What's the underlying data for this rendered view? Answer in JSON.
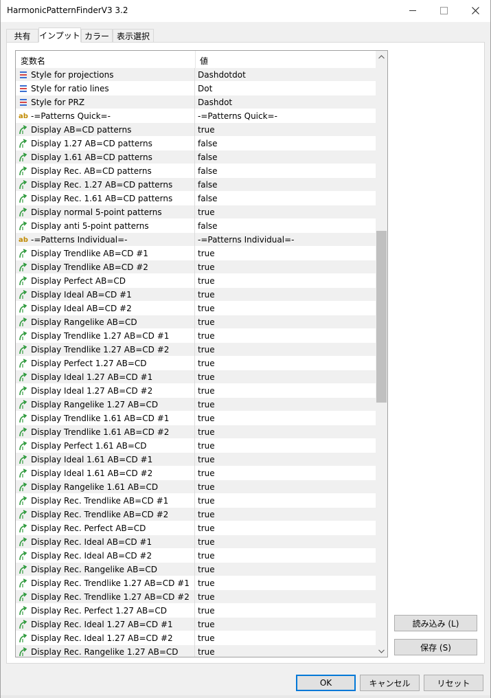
{
  "window": {
    "title": "HarmonicPatternFinderV3 3.2"
  },
  "tabs": [
    {
      "label": "共有",
      "active": false
    },
    {
      "label": "インプット",
      "active": true
    },
    {
      "label": "カラー",
      "active": false
    },
    {
      "label": "表示選択",
      "active": false
    }
  ],
  "grid": {
    "headers": {
      "name": "変数名",
      "value": "値"
    },
    "rows": [
      {
        "icon": "line-style-icon",
        "name": "Style for projections",
        "value": "Dashdotdot"
      },
      {
        "icon": "line-style-icon",
        "name": "Style for ratio lines",
        "value": "Dot"
      },
      {
        "icon": "line-style-icon",
        "name": "Style for PRZ",
        "value": "Dashdot"
      },
      {
        "icon": "string-ab-icon",
        "name": "-=Patterns Quick=-",
        "value": "-=Patterns Quick=-"
      },
      {
        "icon": "bool-arrow-icon",
        "name": "Display AB=CD patterns",
        "value": "true"
      },
      {
        "icon": "bool-arrow-icon",
        "name": "Display 1.27 AB=CD patterns",
        "value": "false"
      },
      {
        "icon": "bool-arrow-icon",
        "name": "Display 1.61 AB=CD patterns",
        "value": "false"
      },
      {
        "icon": "bool-arrow-icon",
        "name": "Display Rec. AB=CD patterns",
        "value": "false"
      },
      {
        "icon": "bool-arrow-icon",
        "name": "Display Rec. 1.27 AB=CD patterns",
        "value": "false"
      },
      {
        "icon": "bool-arrow-icon",
        "name": "Display Rec. 1.61 AB=CD patterns",
        "value": "false"
      },
      {
        "icon": "bool-arrow-icon",
        "name": "Display normal 5-point patterns",
        "value": "true"
      },
      {
        "icon": "bool-arrow-icon",
        "name": "Display anti 5-point patterns",
        "value": "false"
      },
      {
        "icon": "string-ab-icon",
        "name": "-=Patterns Individual=-",
        "value": "-=Patterns Individual=-"
      },
      {
        "icon": "bool-arrow-icon",
        "name": "Display Trendlike AB=CD #1",
        "value": "true"
      },
      {
        "icon": "bool-arrow-icon",
        "name": "Display Trendlike AB=CD #2",
        "value": "true"
      },
      {
        "icon": "bool-arrow-icon",
        "name": "Display Perfect AB=CD",
        "value": "true"
      },
      {
        "icon": "bool-arrow-icon",
        "name": "Display Ideal AB=CD #1",
        "value": "true"
      },
      {
        "icon": "bool-arrow-icon",
        "name": "Display Ideal AB=CD #2",
        "value": "true"
      },
      {
        "icon": "bool-arrow-icon",
        "name": "Display Rangelike AB=CD",
        "value": "true"
      },
      {
        "icon": "bool-arrow-icon",
        "name": "Display Trendlike 1.27 AB=CD #1",
        "value": "true"
      },
      {
        "icon": "bool-arrow-icon",
        "name": "Display Trendlike 1.27 AB=CD #2",
        "value": "true"
      },
      {
        "icon": "bool-arrow-icon",
        "name": "Display Perfect 1.27 AB=CD",
        "value": "true"
      },
      {
        "icon": "bool-arrow-icon",
        "name": "Display Ideal 1.27 AB=CD #1",
        "value": "true"
      },
      {
        "icon": "bool-arrow-icon",
        "name": "Display Ideal 1.27 AB=CD #2",
        "value": "true"
      },
      {
        "icon": "bool-arrow-icon",
        "name": "Display Rangelike 1.27 AB=CD",
        "value": "true"
      },
      {
        "icon": "bool-arrow-icon",
        "name": "Display Trendlike 1.61 AB=CD #1",
        "value": "true"
      },
      {
        "icon": "bool-arrow-icon",
        "name": "Display Trendlike 1.61 AB=CD #2",
        "value": "true"
      },
      {
        "icon": "bool-arrow-icon",
        "name": "Display Perfect 1.61 AB=CD",
        "value": "true"
      },
      {
        "icon": "bool-arrow-icon",
        "name": "Display Ideal 1.61 AB=CD #1",
        "value": "true"
      },
      {
        "icon": "bool-arrow-icon",
        "name": "Display Ideal 1.61 AB=CD #2",
        "value": "true"
      },
      {
        "icon": "bool-arrow-icon",
        "name": "Display Rangelike 1.61 AB=CD",
        "value": "true"
      },
      {
        "icon": "bool-arrow-icon",
        "name": "Display Rec. Trendlike AB=CD #1",
        "value": "true"
      },
      {
        "icon": "bool-arrow-icon",
        "name": "Display Rec. Trendlike AB=CD #2",
        "value": "true"
      },
      {
        "icon": "bool-arrow-icon",
        "name": "Display Rec. Perfect AB=CD",
        "value": "true"
      },
      {
        "icon": "bool-arrow-icon",
        "name": "Display Rec. Ideal AB=CD #1",
        "value": "true"
      },
      {
        "icon": "bool-arrow-icon",
        "name": "Display Rec. Ideal AB=CD #2",
        "value": "true"
      },
      {
        "icon": "bool-arrow-icon",
        "name": "Display Rec. Rangelike AB=CD",
        "value": "true"
      },
      {
        "icon": "bool-arrow-icon",
        "name": "Display Rec. Trendlike 1.27 AB=CD #1",
        "value": "true"
      },
      {
        "icon": "bool-arrow-icon",
        "name": "Display Rec. Trendlike 1.27 AB=CD #2",
        "value": "true"
      },
      {
        "icon": "bool-arrow-icon",
        "name": "Display Rec. Perfect 1.27 AB=CD",
        "value": "true"
      },
      {
        "icon": "bool-arrow-icon",
        "name": "Display Rec. Ideal 1.27 AB=CD #1",
        "value": "true"
      },
      {
        "icon": "bool-arrow-icon",
        "name": "Display Rec. Ideal 1.27 AB=CD #2",
        "value": "true"
      },
      {
        "icon": "bool-arrow-icon",
        "name": "Display Rec. Rangelike 1.27 AB=CD",
        "value": "true"
      }
    ]
  },
  "side_buttons": {
    "load": "読み込み (L)",
    "save": "保存 (S)"
  },
  "footer": {
    "ok": "OK",
    "cancel": "キャンセル",
    "reset": "リセット"
  },
  "colors": {
    "accent": "#0078d7",
    "row_alt": "#f0f0f0",
    "icon_green": "#2e9a3c",
    "icon_blue": "#3b6fd0",
    "icon_red": "#d64545"
  }
}
